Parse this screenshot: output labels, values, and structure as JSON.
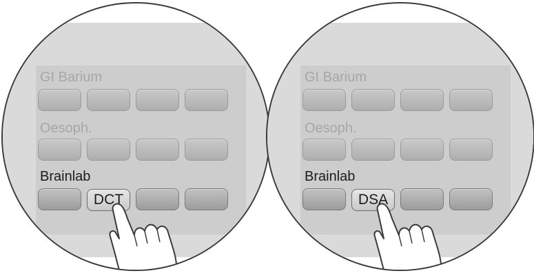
{
  "panels": [
    {
      "sections": [
        {
          "label": "GI Barium",
          "state": "dimmed"
        },
        {
          "label": "Oesoph.",
          "state": "dimmed"
        },
        {
          "label": "Brainlab",
          "state": "active",
          "selected_button_label": "DCT"
        }
      ]
    },
    {
      "sections": [
        {
          "label": "GI Barium",
          "state": "dimmed"
        },
        {
          "label": "Oesoph.",
          "state": "dimmed"
        },
        {
          "label": "Brainlab",
          "state": "active",
          "selected_button_label": "DSA"
        }
      ]
    }
  ],
  "colors": {
    "screen_bg": "#dadada",
    "panel_bg": "#cdcdcd",
    "dim_text": "#a6a6a6",
    "active_text": "#1c1c1c",
    "outline": "#3a3a3a"
  },
  "icons": [
    "pointing-hand-icon"
  ]
}
